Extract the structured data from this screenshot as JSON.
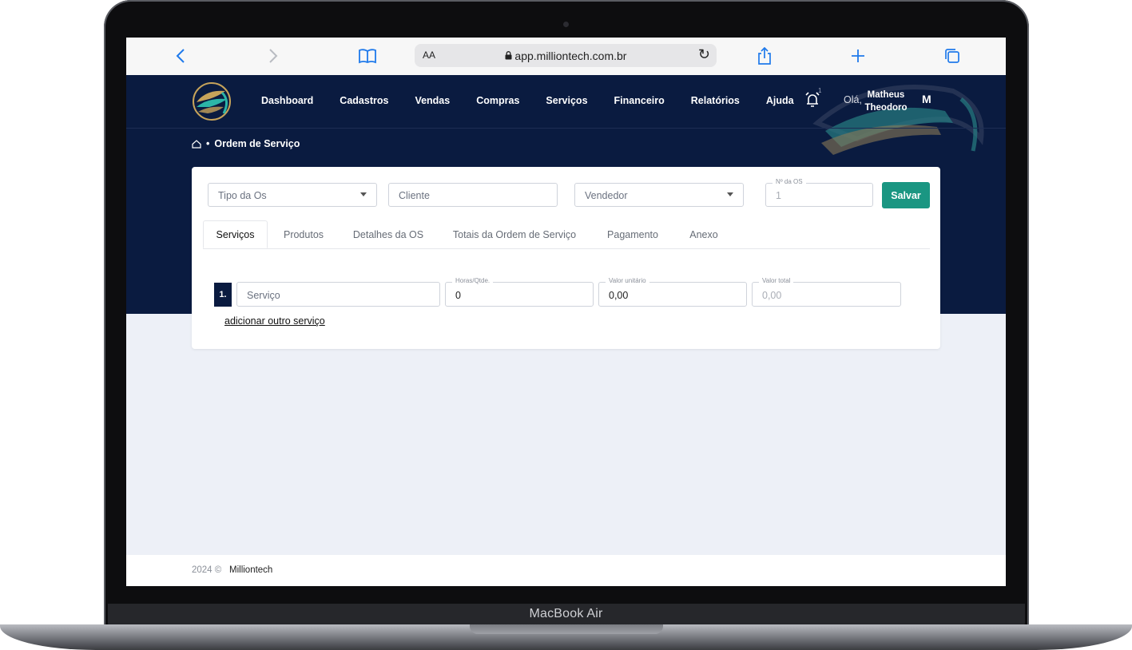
{
  "device": {
    "model_label": "MacBook Air"
  },
  "browser": {
    "text_size_label": "AA",
    "url": "app.milliontech.com.br",
    "icons": [
      "back-icon",
      "forward-icon",
      "bookmarks-icon",
      "lock-icon",
      "reload-icon",
      "share-icon",
      "new-tab-icon",
      "tabs-icon"
    ]
  },
  "header": {
    "nav": [
      "Dashboard",
      "Cadastros",
      "Vendas",
      "Compras",
      "Serviços",
      "Financeiro",
      "Relatórios",
      "Ajuda"
    ],
    "notification_count": "1",
    "greeting": "Olá,",
    "user_name": "Matheus Theodoro",
    "avatar_initial": "M",
    "breadcrumb": "Ordem de Serviço"
  },
  "form": {
    "tipo_os": {
      "placeholder": "Tipo da Os"
    },
    "cliente": {
      "placeholder": "Cliente"
    },
    "vendedor": {
      "placeholder": "Vendedor"
    },
    "numero_os": {
      "label": "Nº da OS",
      "value": "1"
    },
    "save_label": "Salvar"
  },
  "tabs": [
    "Serviços",
    "Produtos",
    "Detalhes da OS",
    "Totais da Ordem de Serviço",
    "Pagamento",
    "Anexo"
  ],
  "active_tab": "Serviços",
  "service_row": {
    "number": "1.",
    "servico_placeholder": "Serviço",
    "horas_label": "Horas/Qtde.",
    "horas_value": "0",
    "valor_unitario_label": "Valor unitário",
    "valor_unitario_value": "0,00",
    "valor_total_label": "Valor total",
    "valor_total_value": "0,00"
  },
  "add_service_label": "adicionar outro serviço",
  "footer": {
    "year": "2024 ©",
    "company": "Milliontech"
  },
  "colors": {
    "header_bg": "#0a1b40",
    "accent": "#1a9682",
    "browser_blue": "#1f7aeb"
  }
}
